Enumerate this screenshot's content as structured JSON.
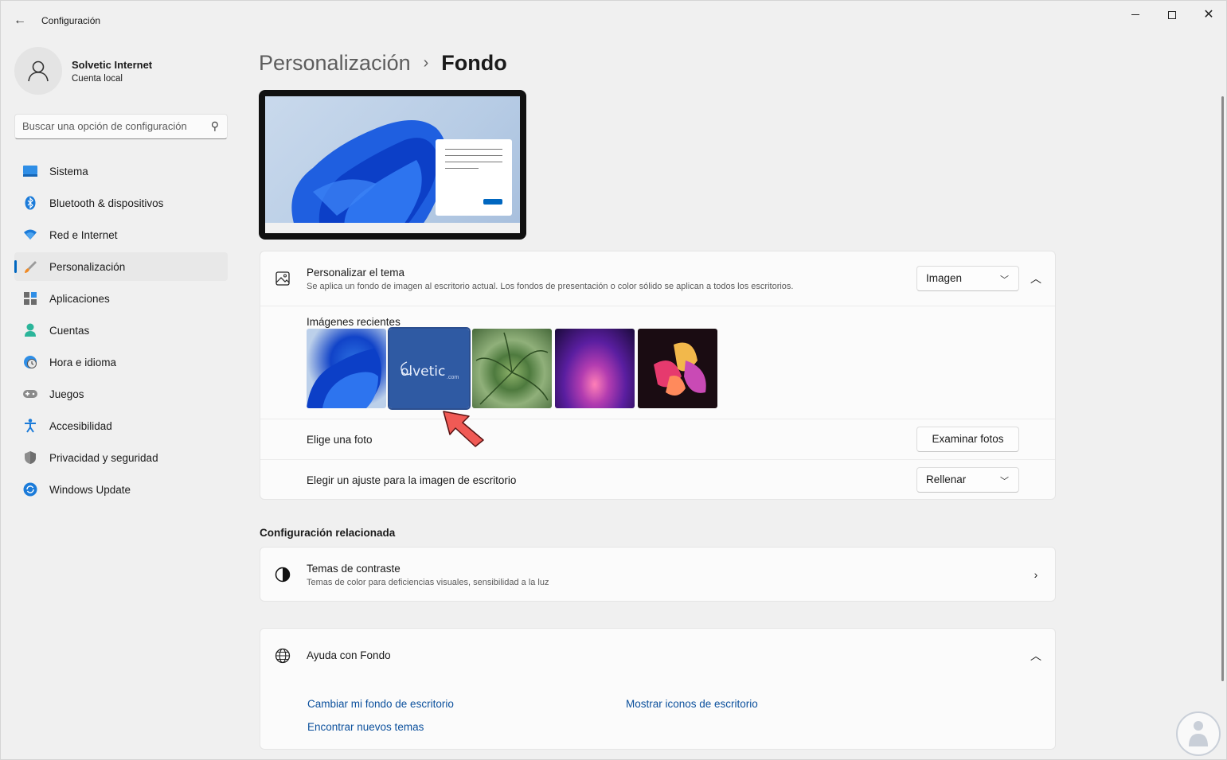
{
  "window": {
    "title": "Configuración"
  },
  "profile": {
    "name": "Solvetic Internet",
    "account_type": "Cuenta local"
  },
  "search": {
    "placeholder": "Buscar una opción de configuración"
  },
  "sidebar": {
    "items": [
      {
        "label": "Sistema",
        "icon": "monitor-icon"
      },
      {
        "label": "Bluetooth & dispositivos",
        "icon": "bluetooth-icon"
      },
      {
        "label": "Red e Internet",
        "icon": "wifi-icon"
      },
      {
        "label": "Personalización",
        "icon": "paintbrush-icon",
        "active": true
      },
      {
        "label": "Aplicaciones",
        "icon": "apps-icon"
      },
      {
        "label": "Cuentas",
        "icon": "person-icon"
      },
      {
        "label": "Hora e idioma",
        "icon": "clock-globe-icon"
      },
      {
        "label": "Juegos",
        "icon": "gamepad-icon"
      },
      {
        "label": "Accesibilidad",
        "icon": "accessibility-icon"
      },
      {
        "label": "Privacidad y seguridad",
        "icon": "shield-icon"
      },
      {
        "label": "Windows Update",
        "icon": "refresh-icon"
      }
    ]
  },
  "breadcrumb": {
    "parent": "Personalización",
    "separator": "›",
    "current": "Fondo"
  },
  "theme_card": {
    "title": "Personalizar el tema",
    "subtitle": "Se aplica un fondo de imagen al escritorio actual. Los fondos de presentación o color sólido se aplican a todos los escritorios.",
    "dropdown_value": "Imagen",
    "recent_label": "Imágenes recientes",
    "thumbnails": [
      {
        "name": "windows-bloom"
      },
      {
        "name": "solvetic-logo",
        "text": "olvetic",
        "suffix": ".com"
      },
      {
        "name": "succulent-plant"
      },
      {
        "name": "purple-glow"
      },
      {
        "name": "flower-abstract"
      }
    ],
    "choose_photo_label": "Elige una foto",
    "browse_button": "Examinar fotos",
    "fit_label": "Elegir un ajuste para la imagen de escritorio",
    "fit_value": "Rellenar"
  },
  "related": {
    "heading": "Configuración relacionada",
    "contrast_title": "Temas de contraste",
    "contrast_subtitle": "Temas de color para deficiencias visuales, sensibilidad a la luz"
  },
  "help": {
    "title": "Ayuda con Fondo",
    "links": [
      "Cambiar mi fondo de escritorio",
      "Mostrar iconos de escritorio",
      "Encontrar nuevos temas"
    ]
  },
  "colors": {
    "accent": "#0067c0",
    "link": "#0a4f9c",
    "arrow": "#f05a55"
  }
}
